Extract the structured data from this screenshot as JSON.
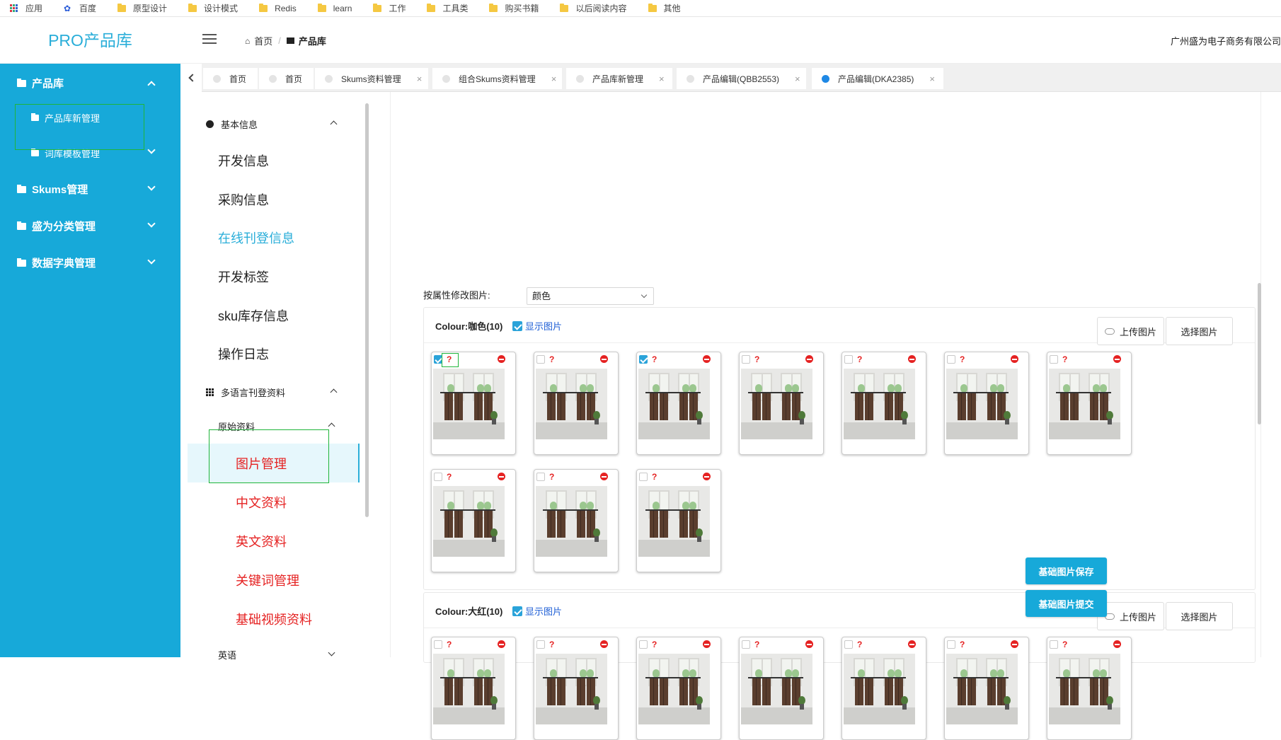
{
  "bookmarks": {
    "apps": "应用",
    "items": [
      "百度",
      "原型设计",
      "设计模式",
      "Redis",
      "learn",
      "工作",
      "工具类",
      "购买书籍",
      "以后阅读内容",
      "其他"
    ]
  },
  "header": {
    "logo": "PRO产品库",
    "breadcrumb": {
      "home": "首页",
      "sep": "/",
      "current": "产品库"
    },
    "company": "广州盛为电子商务有限公司"
  },
  "sidebar": {
    "groups": [
      {
        "label": "产品库",
        "expanded": true
      },
      {
        "label": "Skums管理",
        "expanded": false
      },
      {
        "label": "盛为分类管理",
        "expanded": false
      },
      {
        "label": "数据字典管理",
        "expanded": false
      }
    ],
    "sub_items": [
      "产品库新管理",
      "词库模板管理"
    ]
  },
  "tabs": [
    {
      "label": "首页",
      "active": false,
      "closable": false
    },
    {
      "label": "首页",
      "active": false,
      "closable": false
    },
    {
      "label": "Skums资料管理",
      "active": false,
      "closable": true
    },
    {
      "label": "组合Skums资料管理",
      "active": false,
      "closable": true
    },
    {
      "label": "产品库新管理",
      "active": false,
      "closable": true
    },
    {
      "label": "产品编辑(QBB2553)",
      "active": false,
      "closable": true
    },
    {
      "label": "产品编辑(DKA2385)",
      "active": true,
      "closable": true
    }
  ],
  "leftnav": {
    "basic_section": "基本信息",
    "links": [
      "开发信息",
      "采购信息",
      "在线刊登信息",
      "开发标签",
      "sku库存信息",
      "操作日志"
    ],
    "active_link": "在线刊登信息",
    "multilang_section": "多语言刊登资料",
    "raw_section": "原始资料",
    "raw_items": [
      "图片管理",
      "中文资料",
      "英文资料",
      "关键词管理",
      "基础视频资料"
    ],
    "current_raw_item": "图片管理",
    "english_section": "英语"
  },
  "content": {
    "attr_label": "按属性修改图片:",
    "attr_select_value": "颜色",
    "show_images_label": "显示图片",
    "upload_label": "上传图片",
    "select_label": "选择图片",
    "question_mark": "?",
    "colors": [
      {
        "title": "Colour:咖色(10)",
        "show_images": true,
        "image_checked": [
          true,
          false,
          true,
          false,
          false,
          false,
          false,
          false,
          false,
          false
        ]
      },
      {
        "title": "Colour:大红(10)",
        "show_images": true,
        "image_checked": [
          false,
          false,
          false,
          false,
          false,
          false,
          false
        ]
      }
    ],
    "save_button": "基础图片保存",
    "submit_button": "基础图片提交"
  },
  "colors": {
    "sidebar": "#17a9d9",
    "accent": "#2aaed9",
    "highlight_red": "#e52222",
    "active_tab_dot": "#1e88e5"
  }
}
